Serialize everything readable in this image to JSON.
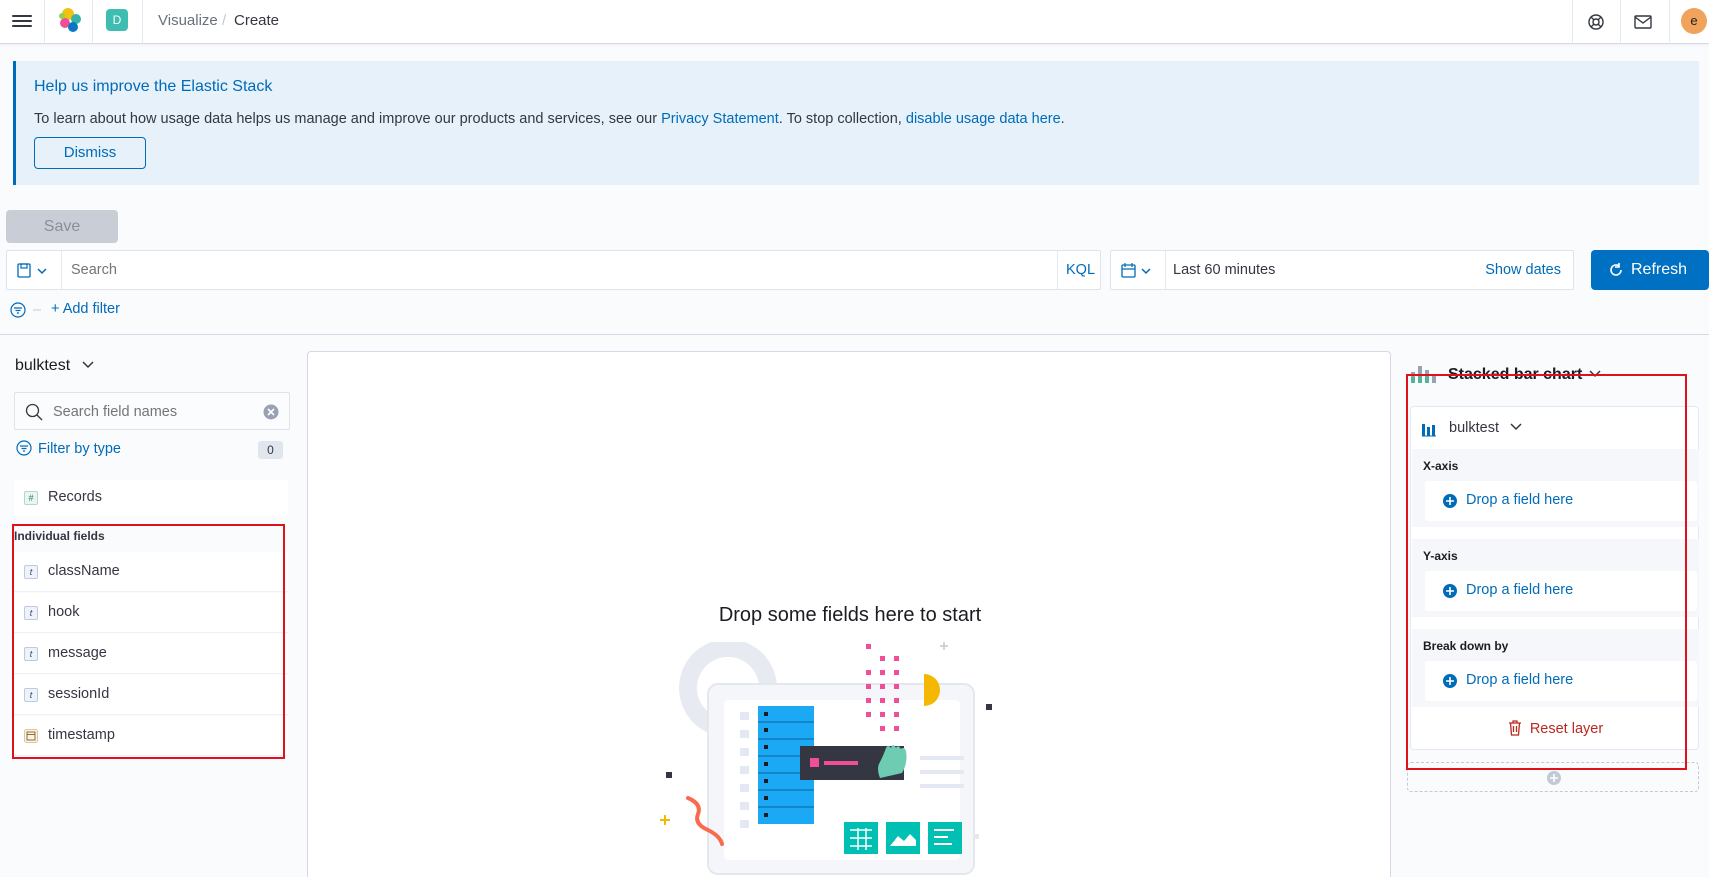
{
  "header": {
    "space_initial": "D",
    "breadcrumbs": [
      "Visualize",
      "Create"
    ],
    "breadcrumb_separator": "/",
    "user_initial": "e",
    "icons": [
      "menu-icon",
      "elastic-logo",
      "help-icon",
      "mail-icon"
    ]
  },
  "callout": {
    "title": "Help us improve the Elastic Stack",
    "text_before": "To learn about how usage data helps us manage and improve our products and services, see our ",
    "privacy_link": "Privacy Statement",
    "text_middle": ". To stop collection, ",
    "disable_link": "disable usage data here",
    "text_after": ".",
    "dismiss_label": "Dismiss"
  },
  "toolbar": {
    "save_label": "Save"
  },
  "query": {
    "search_placeholder": "Search",
    "language": "KQL",
    "time_range": "Last 60 minutes",
    "show_dates": "Show dates",
    "refresh_label": "Refresh"
  },
  "filters": {
    "add_filter": "+ Add filter"
  },
  "index_panel": {
    "index_pattern": "bulktest",
    "search_placeholder": "Search field names",
    "filter_by_type": "Filter by type",
    "filter_count": "0",
    "records": {
      "type": "#",
      "name": "Records"
    },
    "individual_fields_title": "Individual fields",
    "fields": [
      {
        "type": "t",
        "name": "className"
      },
      {
        "type": "t",
        "name": "hook"
      },
      {
        "type": "t",
        "name": "message"
      },
      {
        "type": "t",
        "name": "sessionId"
      },
      {
        "type": "date",
        "name": "timestamp"
      }
    ]
  },
  "workspace": {
    "empty_title": "Drop some fields here to start"
  },
  "config_panel": {
    "chart_type": "Stacked bar chart",
    "layer_index_pattern": "bulktest",
    "dimensions": [
      {
        "label": "X-axis",
        "drop_label": "Drop a field here"
      },
      {
        "label": "Y-axis",
        "drop_label": "Drop a field here"
      },
      {
        "label": "Break down by",
        "drop_label": "Drop a field here"
      }
    ],
    "reset_layer": "Reset layer"
  },
  "colors": {
    "primary": "#006bb8",
    "refresh_bg": "#0071c2",
    "danger": "#bd271e",
    "highlight_box": "#e0101d"
  }
}
